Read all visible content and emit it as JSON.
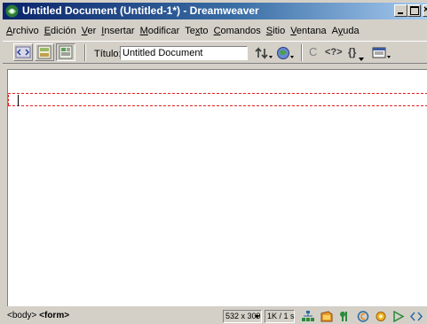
{
  "window": {
    "title": "Untitled Document (Untitled-1*) - Dreamweaver",
    "close_glyph": "×"
  },
  "menubar": [
    {
      "label": "Archivo",
      "accel": "A",
      "rest": "rchivo"
    },
    {
      "label": "Edición",
      "accel": "E",
      "rest": "dición"
    },
    {
      "label": "Ver",
      "accel": "V",
      "rest": "er"
    },
    {
      "label": "Insertar",
      "accel": "I",
      "rest": "nsertar"
    },
    {
      "label": "Modificar",
      "accel": "M",
      "rest": "odificar"
    },
    {
      "label": "Texto",
      "accel": "x",
      "pre": "Te",
      "rest": "to"
    },
    {
      "label": "Comandos",
      "accel": "C",
      "rest": "omandos"
    },
    {
      "label": "Sitio",
      "accel": "S",
      "rest": "itio"
    },
    {
      "label": "Ventana",
      "accel": "V",
      "rest": "entana"
    },
    {
      "label": "Ayuda",
      "accel": "y",
      "pre": "A",
      "rest": "uda"
    }
  ],
  "toolbar": {
    "title_label": "Título:",
    "title_value": "Untitled Document",
    "refresh_glyph": "C",
    "code_glyph": "<?>",
    "braces_glyph": "{}"
  },
  "statusbar": {
    "tag_body": "<body>",
    "tag_form": "<form>",
    "window_size": "532 x 309",
    "download_stats": "1K / 1 s"
  },
  "colors": {
    "title_start": "#0a246a",
    "title_end": "#a6caf0",
    "chrome": "#d4d0c8",
    "form_outline": "#e02020"
  }
}
